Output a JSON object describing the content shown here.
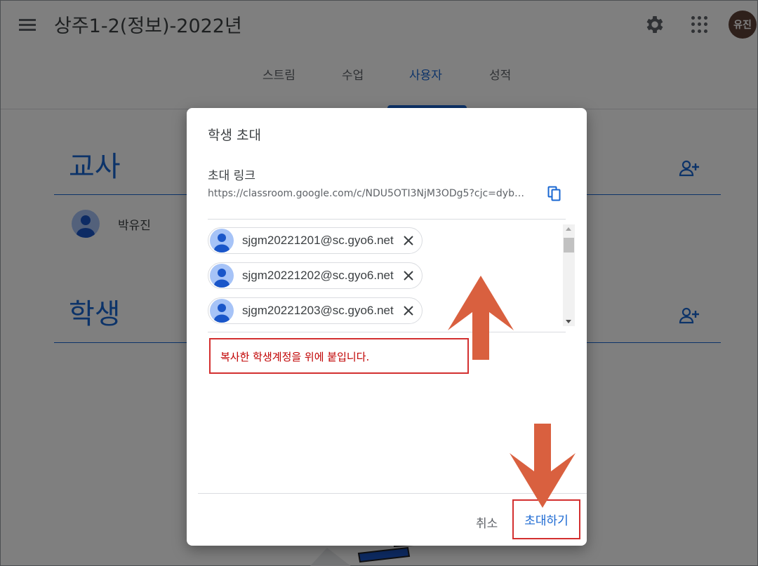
{
  "header": {
    "class_title": "상주1-2(정보)-2022년",
    "avatar_initials": "유진"
  },
  "tabs": [
    {
      "label": "스트림"
    },
    {
      "label": "수업"
    },
    {
      "label": "사용자"
    },
    {
      "label": "성적"
    }
  ],
  "active_tab": "사용자",
  "people": {
    "teachers_heading": "교사",
    "students_heading": "학생",
    "teacher_name": "박유진"
  },
  "dialog": {
    "title": "학생 초대",
    "link_label": "초대 링크",
    "link_url": "https://classroom.google.com/c/NDU5OTI3NjM3ODg5?cjc=dyb…",
    "chips": [
      {
        "email": "sjgm20221201@sc.gyo6.net"
      },
      {
        "email": "sjgm20221202@sc.gyo6.net"
      },
      {
        "email": "sjgm20221203@sc.gyo6.net"
      }
    ],
    "note": "복사한 학생계정을 위에 붙입니다.",
    "cancel_label": "취소",
    "invite_label": "초대하기"
  },
  "colors": {
    "accent": "#1967d2",
    "annotation_red": "#d32f2f",
    "arrow_orange": "#d9603f",
    "overlay": "rgba(0,0,0,0.5)"
  },
  "icons": [
    "menu-icon",
    "settings-gear-icon",
    "apps-grid-icon",
    "add-person-icon",
    "copy-icon",
    "close-icon",
    "person-avatar-icon"
  ]
}
